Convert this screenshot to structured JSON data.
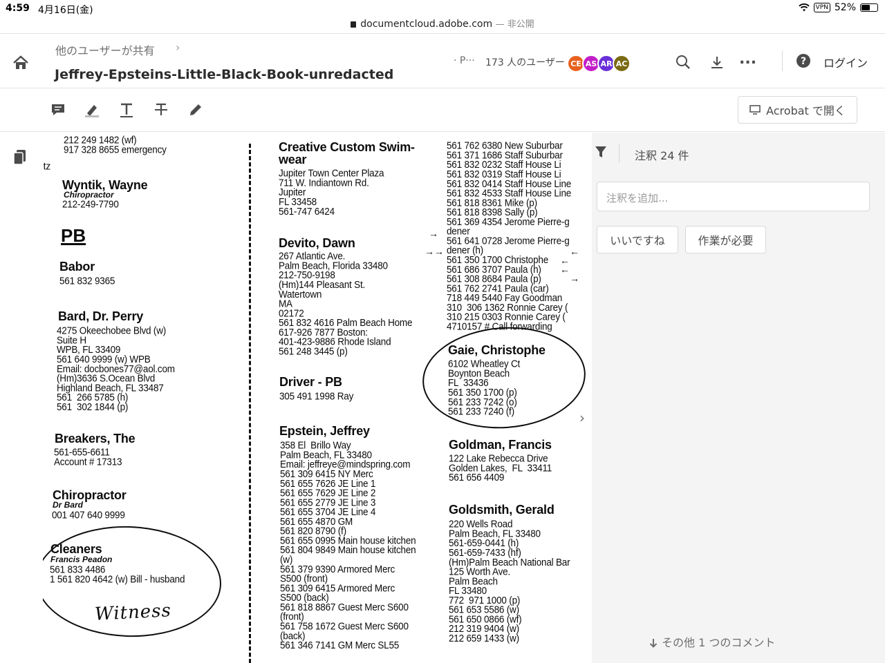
{
  "status": {
    "time": "4:59",
    "date": "4月16日(金)",
    "vpn": "VPN",
    "battery": "52%"
  },
  "browser": {
    "domain": "documentcloud.adobe.com",
    "suffix": "— 非公開"
  },
  "header": {
    "breadcrumb": "他のユーザーが共有",
    "breadcrumb_chevron": "›",
    "title": "Jeffrey-Epsteins-Little-Black-Book-unredacted",
    "page_indicator": "· P···",
    "users_count": "173 人のユーザー",
    "avatars": [
      {
        "initials": "CE",
        "color": "#e8611f"
      },
      {
        "initials": "AS",
        "color": "#c21ec9"
      },
      {
        "initials": "AR",
        "color": "#6a2fd8"
      },
      {
        "initials": "AC",
        "color": "#7a6a12"
      }
    ],
    "more": "...",
    "login": "ログイン"
  },
  "toolbar": {
    "open_in_acrobat": "Acrobat で開く"
  },
  "panel": {
    "comment_count": "注釈 24 件",
    "add_comment_placeholder": "注釈を追加...",
    "like_chip": "いいですね",
    "needs_work_chip": "作業が必要",
    "more_comments": "その他 1 つのコメント"
  },
  "document": {
    "col1": {
      "top_numbers": "212 249 1482 (wf)\n917 328 8655 emergency",
      "itz": "itz",
      "wyntik_name": "Wyntik, Wayne",
      "wyntik_sub": "Chiropractor",
      "wyntik_phone": "212-249-7790",
      "pb_heading": "PB",
      "babor_name": "Babor",
      "babor_phone": "561 832 9365",
      "bard_name": "Bard, Dr. Perry",
      "bard_details": "4275 Okeechobee Blvd (w)\nSuite H\nWPB, FL 33409\n561 640 9999 (w) WPB\nEmail: docbones77@aol.com\n(Hm)3636 S.Ocean Blvd\nHighland Beach, FL 33487\n561  266 5785 (h)\n561  302 1844 (p)",
      "breakers_name": "Breakers, The",
      "breakers_details": "561-655-6611\nAccount # 17313",
      "chiro_name": "Chiropractor",
      "chiro_sub": "Dr Bard",
      "chiro_phone": "001 407 640 9999",
      "cleaners_name": "Cleaners",
      "cleaners_sub": "Francis Peadon",
      "cleaners_details": "561 833 4486\n1 561 820 4642 (w) Bill - husband",
      "handwriting": "Witness"
    },
    "col2": {
      "creative_name": "Creative Custom Swim-\nwear",
      "creative_details": "Jupiter Town Center Plaza\n711 W. Indiantown Rd.\nJupiter\nFL 33458\n561-747 6424",
      "devito_name": "Devito, Dawn",
      "devito_details": "267 Atlantic Ave.\nPalm Beach, Florida 33480\n212-750-9198\n(Hm)144 Pleasant St.\nWatertown\nMA\n02172\n561 832 4616 Palm Beach Home\n617-926 7877 Boston:\n401-423-9886 Rhode Island\n561 248 3445 (p)",
      "driver_name": "Driver - PB",
      "driver_phone": "305 491 1998 Ray",
      "epstein_name": "Epstein, Jeffrey",
      "epstein_details": "358 El  Brillo Way\nPalm Beach, FL 33480\nEmail: jeffreye@mindspring.com\n561 309 6415 NY Merc\n561 655 7626 JE Line 1\n561 655 7629 JE Line 2\n561 655 2779 JE Line 3\n561 655 3704 JE Line 4\n561 655 4870 GM\n561 820 8790 (f)\n561 655 0995 Main house kitchen\n561 804 9849 Main house kitchen\n(w)\n561 379 9390 Armored Merc\nS500 (front)\n561 309 6415 Armored Merc\nS500 (back)\n561 818 8867 Guest Merc S600\n(front)\n561 758 1672 Guest Merc S600\n(back)\n561 346 7141 GM Merc SL55"
    },
    "col3": {
      "top_lines": "561 762 6380 New Suburbar\n561 371 1686 Staff Suburbar\n561 832 0232 Staff House Li\n561 832 0319 Staff House Li\n561 832 0414 Staff House Line\n561 832 4533 Staff House Line\n561 818 8361 Mike (p)\n561 818 8398 Sally (p)\n561 369 4354 Jerome Pierre-g\ndener\n561 641 0728 Jerome Pierre-g\ndener (h)\n561 350 1700 Christophe\n561 686 3707 Paula (h)\n561 308 8684 Paula (p)\n561 762 2741 Paula (car)\n718 449 5440 Fay Goodman\n310  306 1362 Ronnie Carey (\n310 215 0303 Ronnie Carey (\n4710157 # Call forwarding",
      "gaie_name": "Gaie, Christophe",
      "gaie_details": "6102 Wheatley Ct\nBoynton Beach\nFL  33436\n561 350 1700 (p)\n561 233 7242 (o)\n561 233 7240 (f)",
      "goldman_name": "Goldman, Francis",
      "goldman_details": "122 Lake Rebecca Drive\nGolden Lakes,  FL  33411\n561 656 4409",
      "goldsmith_name": "Goldsmith, Gerald",
      "goldsmith_details": "220 Wells Road\nPalm Beach, FL 33480\n561-659-0441 (h)\n561-659-7433 (hf)\n(Hm)Palm Beach National Bar\n125 Worth Ave.\nPalm Beach\nFL 33480\n772  971 1000 (p)\n561 653 5586 (w)\n561 650 0866 (wf)\n212 319 9404 (w)\n212 659 1433 (w)"
    }
  },
  "colors": {
    "accent": "#2c2c2c",
    "panel_bg": "#f4f4f4",
    "border": "#d8d8d8"
  },
  "icons": [
    "home-icon",
    "chevron-right-icon",
    "search-icon",
    "download-icon",
    "more-icon",
    "help-icon",
    "comment-icon",
    "highlight-icon",
    "text-icon",
    "strikethrough-icon",
    "pencil-icon",
    "monitor-icon",
    "pages-icon",
    "filter-icon",
    "arrow-down-icon"
  ]
}
